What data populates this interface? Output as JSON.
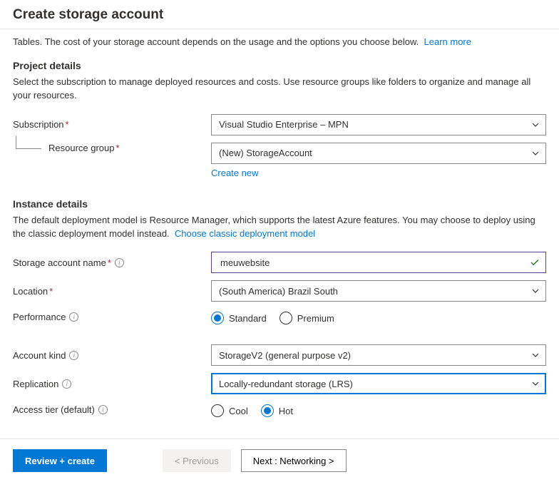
{
  "header": {
    "title": "Create storage account"
  },
  "intro": {
    "text": "Tables. The cost of your storage account depends on the usage and the options you choose below.",
    "link": "Learn more"
  },
  "project": {
    "title": "Project details",
    "desc": "Select the subscription to manage deployed resources and costs. Use resource groups like folders to organize and manage all your resources.",
    "subscription_label": "Subscription",
    "subscription_value": "Visual Studio Enterprise – MPN",
    "resource_group_label": "Resource group",
    "resource_group_value": "(New) StorageAccount",
    "create_new": "Create new"
  },
  "instance": {
    "title": "Instance details",
    "desc": "The default deployment model is Resource Manager, which supports the latest Azure features. You may choose to deploy using the classic deployment model instead.",
    "classic_link": "Choose classic deployment model",
    "name_label": "Storage account name",
    "name_value": "meuwebsite",
    "location_label": "Location",
    "location_value": "(South America) Brazil South",
    "performance_label": "Performance",
    "performance_options": [
      "Standard",
      "Premium"
    ],
    "performance_selected": "Standard",
    "kind_label": "Account kind",
    "kind_value": "StorageV2 (general purpose v2)",
    "replication_label": "Replication",
    "replication_value": "Locally-redundant storage (LRS)",
    "tier_label": "Access tier (default)",
    "tier_options": [
      "Cool",
      "Hot"
    ],
    "tier_selected": "Hot"
  },
  "footer": {
    "review": "Review + create",
    "prev": "< Previous",
    "next": "Next : Networking >"
  }
}
